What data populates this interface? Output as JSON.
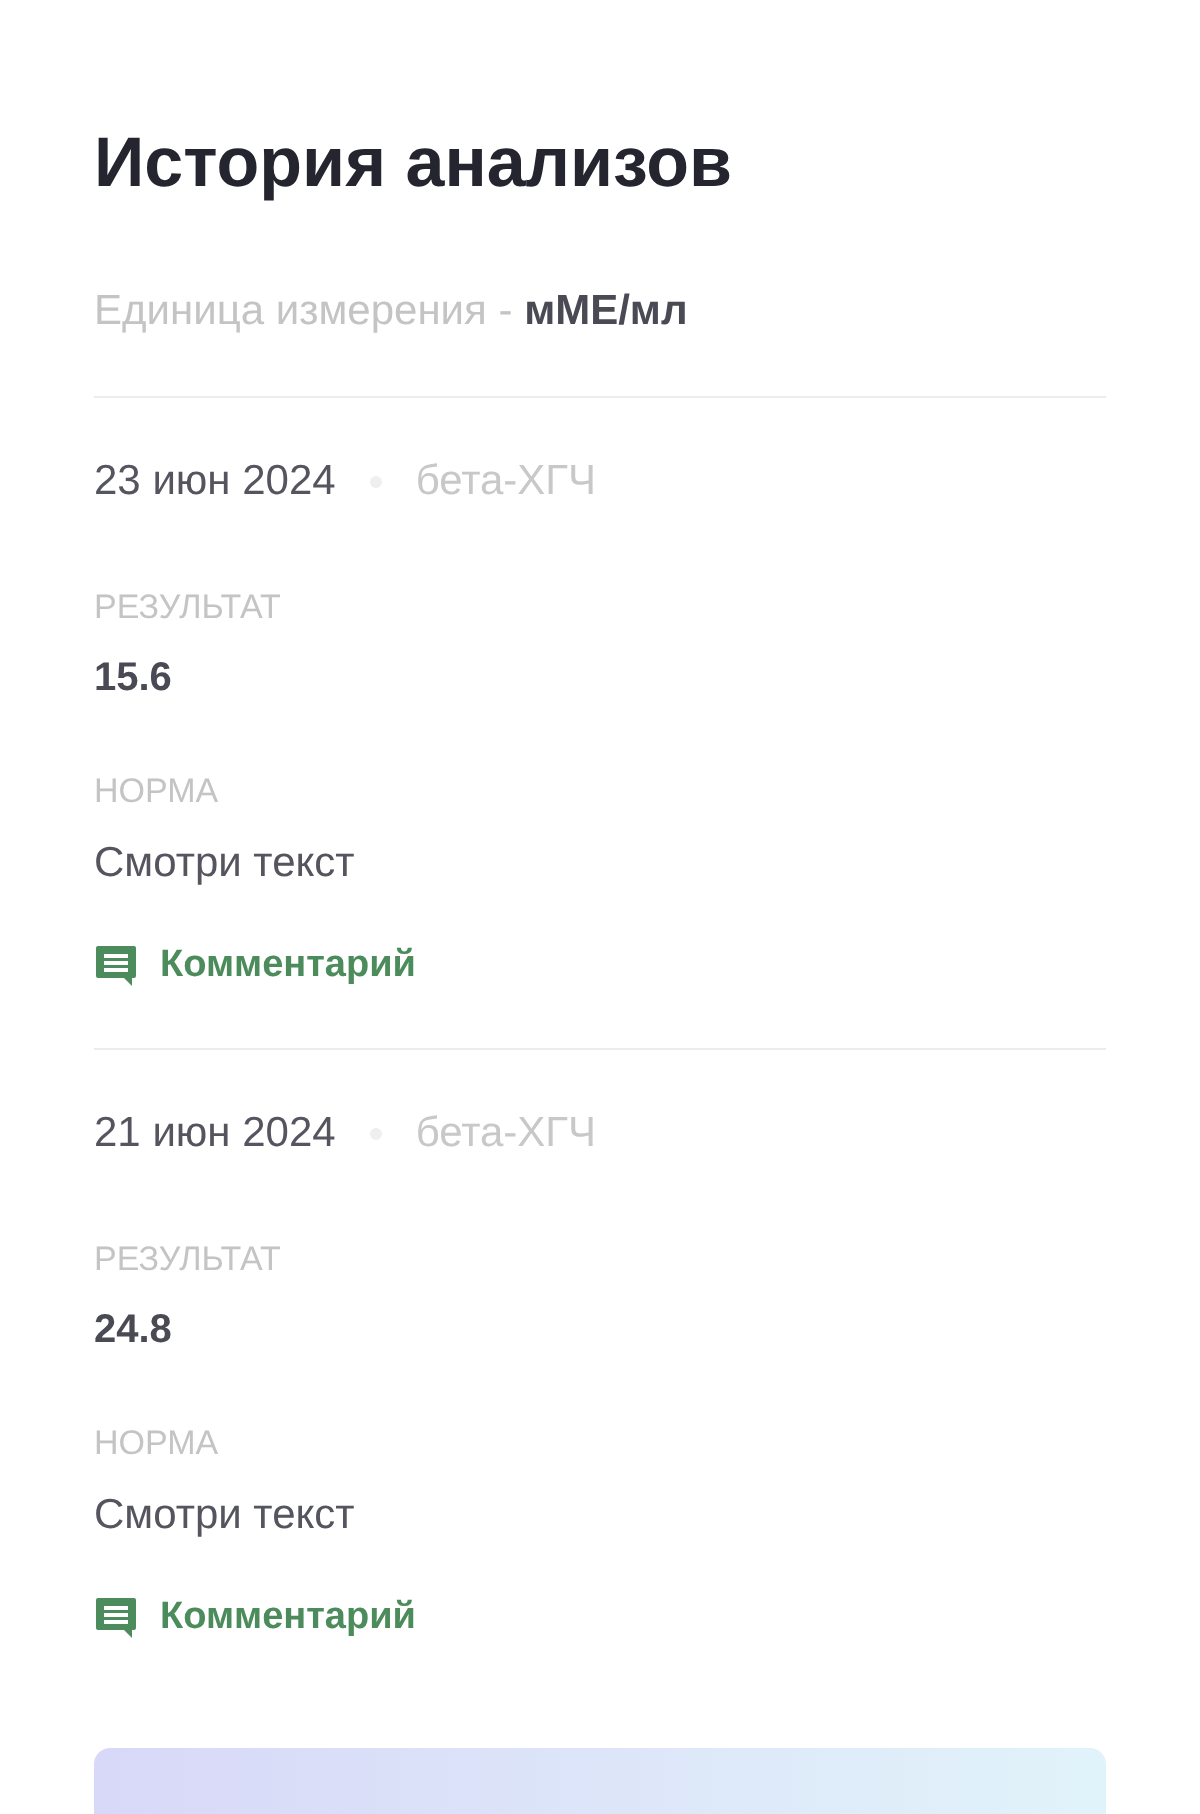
{
  "title": "История анализов",
  "unit": {
    "label": "Единица измерения - ",
    "value": "мМЕ/мл"
  },
  "entries": [
    {
      "date": "23 июн 2024",
      "test": "бета-ХГЧ",
      "result_label": "РЕЗУЛЬТАТ",
      "result": "15.6",
      "norm_label": "НОРМА",
      "norm": "Смотри текст",
      "comment": "Комментарий"
    },
    {
      "date": "21 июн 2024",
      "test": "бета-ХГЧ",
      "result_label": "РЕЗУЛЬТАТ",
      "result": "24.8",
      "norm_label": "НОРМА",
      "norm": "Смотри текст",
      "comment": "Комментарий"
    }
  ]
}
